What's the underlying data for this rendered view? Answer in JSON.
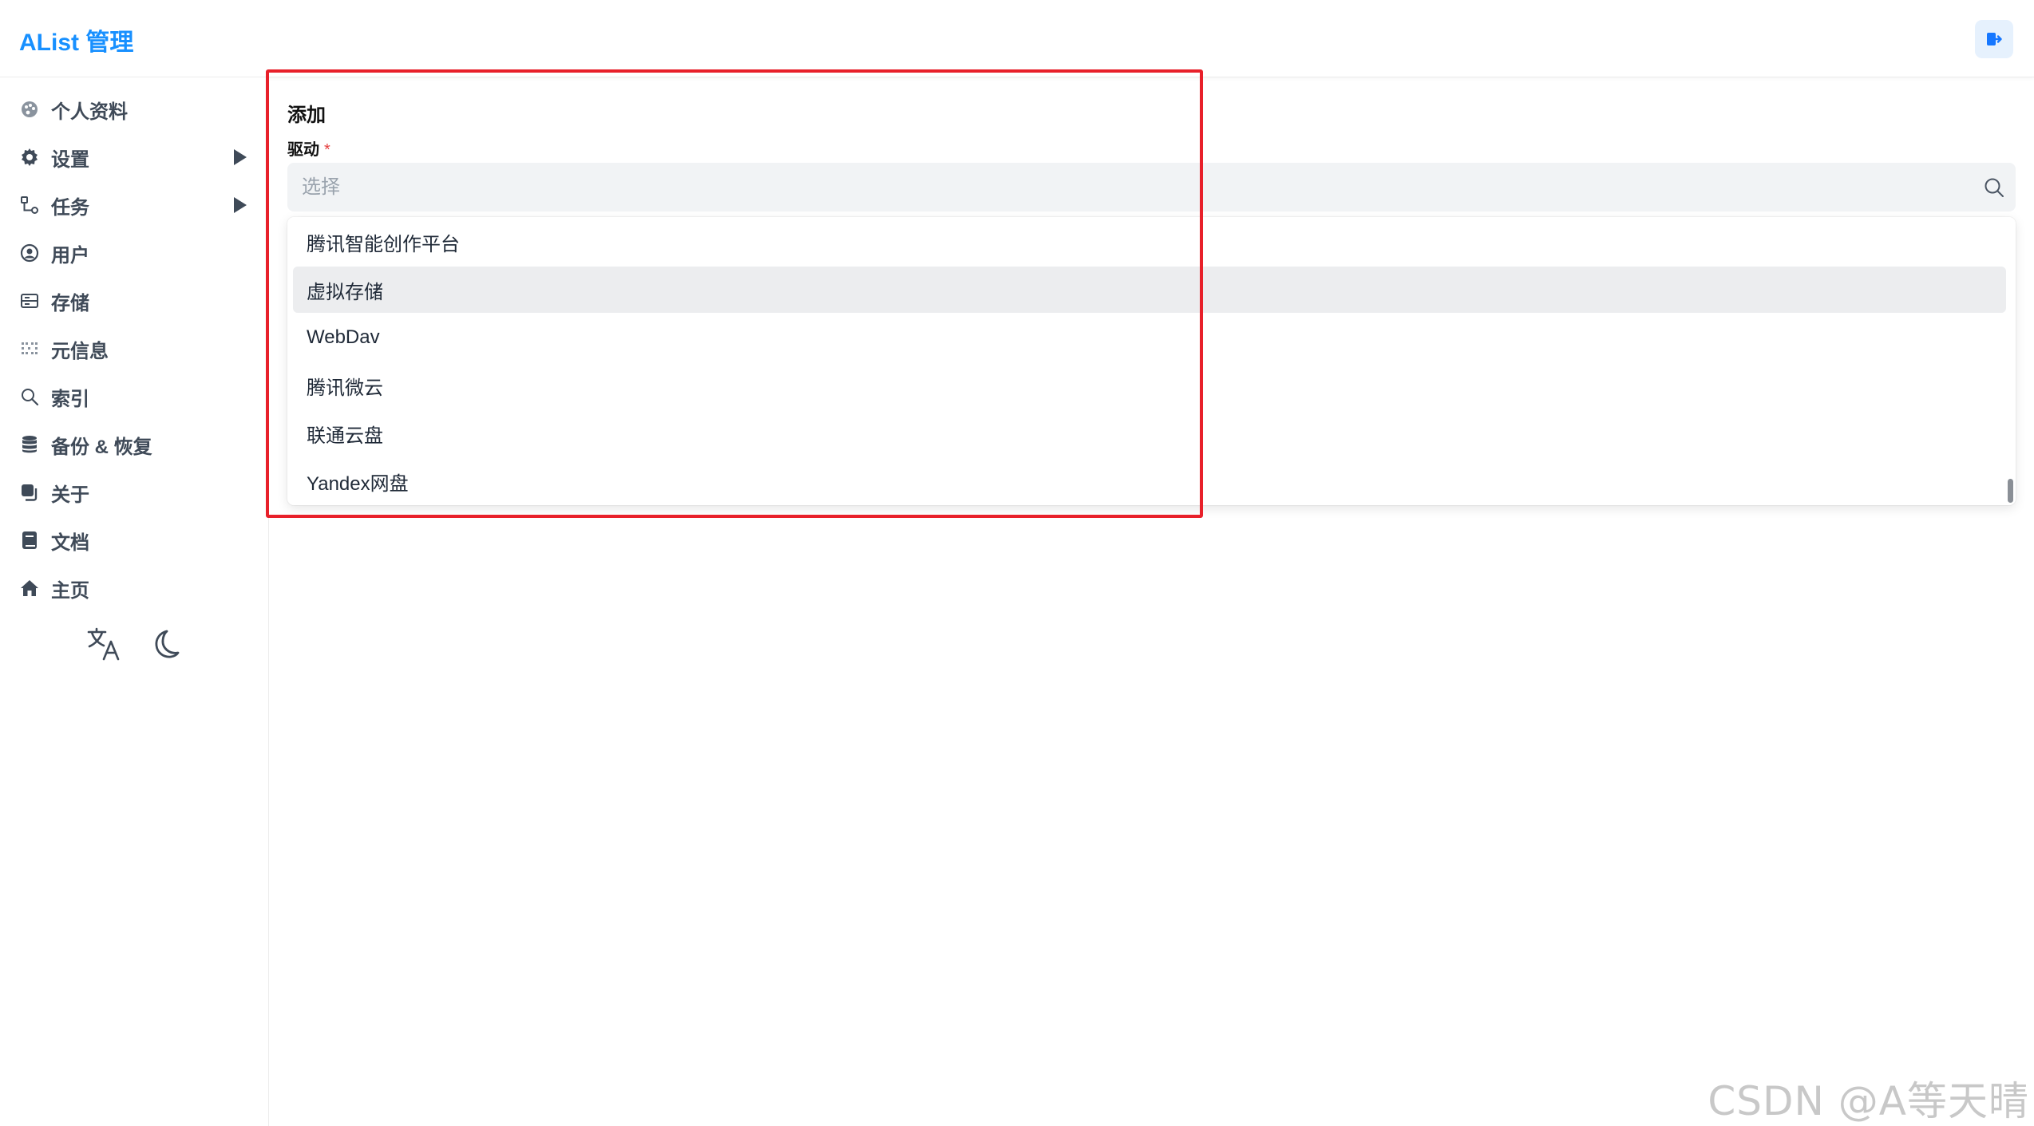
{
  "header": {
    "brand": "AList 管理",
    "logout_icon": "logout-icon",
    "accent_color": "#1890ff"
  },
  "sidebar": {
    "items": [
      {
        "label": "个人资料",
        "icon": "palette-icon",
        "has_submenu": false
      },
      {
        "label": "设置",
        "icon": "gear-icon",
        "has_submenu": true
      },
      {
        "label": "任务",
        "icon": "workflow-icon",
        "has_submenu": true
      },
      {
        "label": "用户",
        "icon": "user-circle-icon",
        "has_submenu": false
      },
      {
        "label": "存储",
        "icon": "storage-icon",
        "has_submenu": false
      },
      {
        "label": "元信息",
        "icon": "meta-icon",
        "has_submenu": false
      },
      {
        "label": "索引",
        "icon": "search-icon",
        "has_submenu": false
      },
      {
        "label": "备份 & 恢复",
        "icon": "database-icon",
        "has_submenu": false
      },
      {
        "label": "关于",
        "icon": "copy-icon",
        "has_submenu": false
      },
      {
        "label": "文档",
        "icon": "book-icon",
        "has_submenu": false
      },
      {
        "label": "主页",
        "icon": "home-icon",
        "has_submenu": false
      }
    ],
    "footer": {
      "language_icon": "translate-icon",
      "theme_icon": "moon-icon"
    }
  },
  "main": {
    "title": "添加",
    "driver_field": {
      "label": "驱动",
      "required_mark": "*",
      "placeholder": "选择",
      "value": ""
    },
    "dropdown": {
      "options": [
        {
          "label": "腾讯智能创作平台",
          "active": false
        },
        {
          "label": "虚拟存储",
          "active": true
        },
        {
          "label": "WebDav",
          "active": false
        },
        {
          "label": "腾讯微云",
          "active": false
        },
        {
          "label": "联通云盘",
          "active": false
        },
        {
          "label": "Yandex网盘",
          "active": false
        }
      ]
    }
  },
  "annotation": {
    "highlight_color": "#e8202a"
  },
  "watermark": "CSDN @A等天晴"
}
